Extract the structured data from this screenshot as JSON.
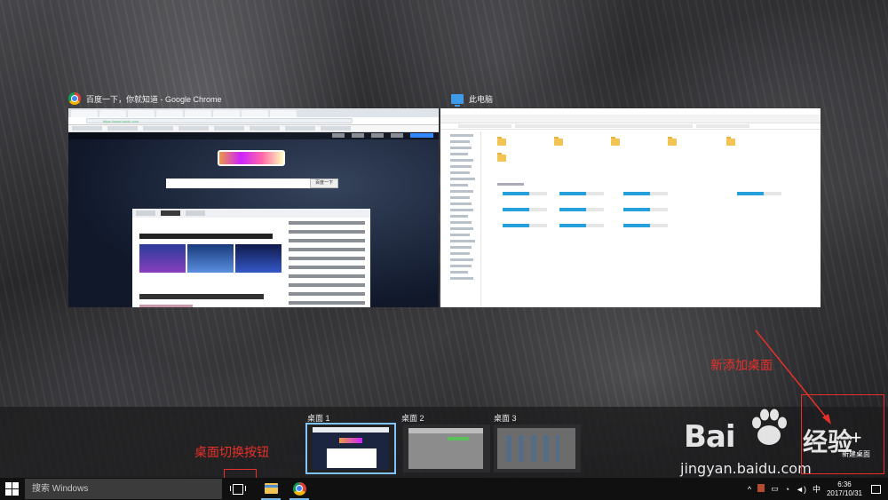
{
  "windows": {
    "chrome": {
      "title": "百度一下，你就知道 - Google Chrome",
      "address": "https://www.baidu.com",
      "search_button": "百度一下"
    },
    "explorer": {
      "title": "此电脑"
    }
  },
  "desktops": {
    "items": [
      {
        "label": "桌面 1",
        "active": true
      },
      {
        "label": "桌面 2",
        "active": false
      },
      {
        "label": "桌面 3",
        "active": false
      }
    ],
    "new_desktop_label": "新建桌面",
    "new_desktop_icon": "plus-icon"
  },
  "annotations": {
    "new_desktop_note": "新添加桌面",
    "switch_button_note": "桌面切换按钮",
    "color": "#e8302a"
  },
  "watermark": {
    "brand": "Bai",
    "brand_suffix": "经验",
    "url": "jingyan.baidu.com"
  },
  "taskbar": {
    "search_placeholder": "搜索 Windows",
    "apps": [
      "file-explorer-icon",
      "chrome-icon"
    ],
    "tray": {
      "chevron": "^",
      "ime": "中",
      "time": "6:36",
      "date": "2017/10/31"
    }
  },
  "colors": {
    "taskbar": "#101010",
    "active_outline": "#7fc3ff",
    "accent": "#76b9ed"
  }
}
